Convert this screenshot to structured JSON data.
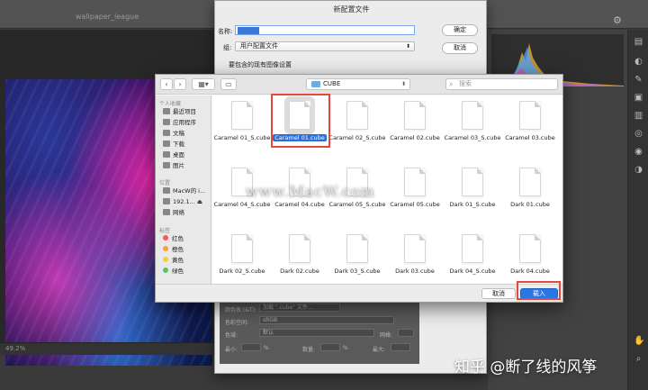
{
  "photoshop": {
    "doc_title": "wallpaper_league",
    "zoom": "49.2%"
  },
  "sheet": {
    "title": "新配置文件",
    "name_label": "名称:",
    "profile_label": "组:",
    "profile_value": "用户配置文件",
    "include_label": "要包含的现有图像设置",
    "ok": "确定",
    "cancel": "取消",
    "lower": {
      "color_table_label": "颜色表 (&T):",
      "color_table_value": "加载 \".cube\" 文件...",
      "color_space_label": "色彩空间:",
      "color_space_value": "sRGB",
      "color_range_label": "色域:",
      "color_range_value": "默认",
      "grid_label": "网格:",
      "min_label": "最小:",
      "max_label": "最大:",
      "count_label": "数量:",
      "percent": "%"
    }
  },
  "file_dialog": {
    "folder": "CUBE",
    "search_placeholder": "搜索",
    "sidebar": {
      "favorites_header": "个人收藏",
      "favorites": [
        "最近项目",
        "应用程序",
        "文稿",
        "下载",
        "桌面",
        "图片"
      ],
      "locations_header": "位置",
      "locations": [
        "MacW的 i...",
        "192.1...",
        "网络"
      ],
      "tags_header": "标签",
      "tags": [
        {
          "label": "红色",
          "color": "#f15c5c"
        },
        {
          "label": "橙色",
          "color": "#f5a23a"
        },
        {
          "label": "黄色",
          "color": "#f2d23c"
        },
        {
          "label": "绿色",
          "color": "#5cc464"
        }
      ]
    },
    "files": [
      "Caramel 01_S.cube",
      "Caramel 01.cube",
      "Caramel 02_S.cube",
      "Caramel 02.cube",
      "Caramel 03_S.cube",
      "Caramel 03.cube",
      "Caramel 04_S.cube",
      "Caramel 04.cube",
      "Caramel 05_S.cube",
      "Caramel 05.cube",
      "Dark 01_S.cube",
      "Dark 01.cube",
      "Dark 02_S.cube",
      "Dark 02.cube",
      "Dark 03_S.cube",
      "Dark 03.cube",
      "Dark 04_S.cube",
      "Dark 04.cube"
    ],
    "selected_file": "Caramel 01.cube",
    "cancel": "取消",
    "open": "载入"
  },
  "overlays": {
    "watermark": "www.MacW.com",
    "attribution": "知乎 @断了线的风筝"
  },
  "colors": {
    "highlight": "#e34a3c",
    "selection": "#2e6fd6",
    "primary_button": "#2a76e5"
  }
}
